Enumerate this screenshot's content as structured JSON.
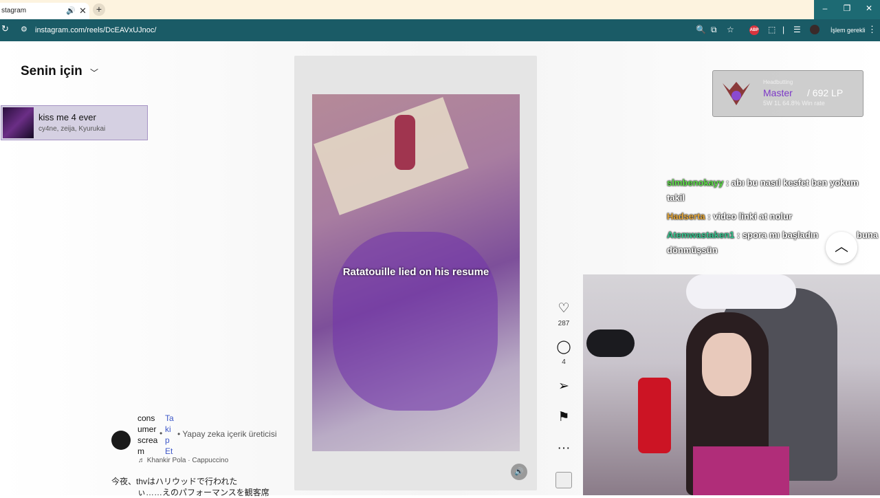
{
  "browser": {
    "tab_title": "stagram",
    "tab_audio_icon": "speaker-icon",
    "tab_close": "✕",
    "new_tab": "+",
    "url": "instagram.com/reels/DcEAVxUJnoc/",
    "profile_status": "İşlem gerekli",
    "adblock_label": "ABP",
    "window_controls": [
      "–",
      "❐",
      "✕"
    ]
  },
  "feed": {
    "title": "Senin için",
    "chevron": "⌄"
  },
  "song_card": {
    "title": "kiss me 4 ever",
    "artists": "cy4ne, zeija, Kyurukai"
  },
  "reel": {
    "caption": "Ratatouille lied on his resume",
    "like_count": "287",
    "comment_count": "4",
    "author": {
      "name": "consumerscream",
      "follow": "Takip Et",
      "separator": "•",
      "ai_label": "• Yapay zeka içerik üreticisi"
    },
    "audio": "♬ Khankir Pola · Cappuccino",
    "description_line1": "今夜、thvはハリウッドで行われた",
    "description_line2": "ぃ……えのパフォーマンスを観客席"
  },
  "rank_overlay": {
    "tier": "Master",
    "lp": "/ 692 LP",
    "line_top": "Headbutting",
    "line_bottom": "5W 1L  64.8% Win rate"
  },
  "chat": [
    {
      "user": "slmbenokayy",
      "color": "#5ee04a",
      "message": " : abı bu nasıl kesfet ben yokum",
      "message_cont": "takil"
    },
    {
      "user": "Hadserta",
      "color": "#e8a93a",
      "message": " : video linki at nolur"
    },
    {
      "user": "Atemwastaken1",
      "color": "#36c48e",
      "message": " : spora mı başladın",
      "message_cont": "buna",
      "message_cont2": "dönmüşsün"
    }
  ],
  "actions": {
    "more": "···"
  },
  "icons": {
    "like": "heart-icon",
    "comment": "comment-icon",
    "share": "send-icon",
    "save": "bookmark-icon"
  }
}
